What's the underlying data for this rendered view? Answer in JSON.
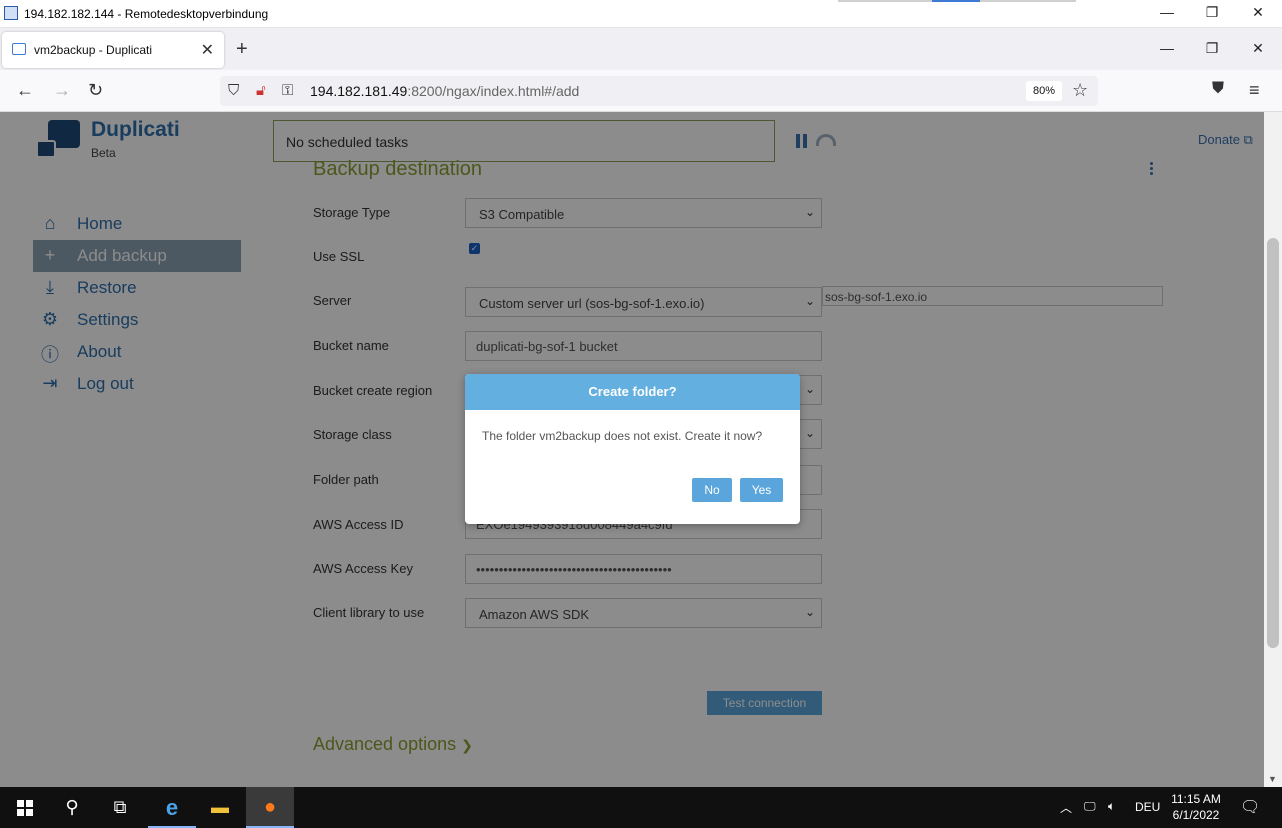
{
  "rdp": {
    "title": "194.182.182.144 - Remotedesktopverbindung"
  },
  "window_controls": {
    "minimize": "—",
    "restore": "❐",
    "close": "✕"
  },
  "browser": {
    "tab_title": "vm2backup - Duplicati",
    "url_host": "194.182.181.49",
    "url_rest": ":8200/ngax/index.html#/add",
    "zoom": "80%"
  },
  "app": {
    "name": "Duplicati",
    "subtitle": "Beta",
    "status": "No scheduled tasks",
    "donate": "Donate",
    "section_title": "Backup destination",
    "advanced_options": "Advanced options"
  },
  "sidebar": {
    "items": [
      {
        "label": "Home",
        "icon": "home-icon",
        "active": false
      },
      {
        "label": "Add backup",
        "icon": "plus-icon",
        "active": true
      },
      {
        "label": "Restore",
        "icon": "restore-icon",
        "active": false
      },
      {
        "label": "Settings",
        "icon": "gear-icon",
        "active": false
      },
      {
        "label": "About",
        "icon": "info-icon",
        "active": false
      },
      {
        "label": "Log out",
        "icon": "logout-icon",
        "active": false
      }
    ]
  },
  "form": {
    "storage_type": {
      "label": "Storage Type",
      "value": "S3 Compatible"
    },
    "use_ssl": {
      "label": "Use SSL",
      "checked": true
    },
    "server": {
      "label": "Server",
      "value": "Custom server url (sos-bg-sof-1.exo.io)",
      "custom_value": "sos-bg-sof-1.exo.io"
    },
    "bucket_name": {
      "label": "Bucket name",
      "value": "duplicati-bg-sof-1 bucket"
    },
    "bucket_region": {
      "label": "Bucket create region"
    },
    "storage_class": {
      "label": "Storage class"
    },
    "folder_path": {
      "label": "Folder path"
    },
    "aws_access_id": {
      "label": "AWS Access ID",
      "value": "EXOe1949393918d008449a4c9fd"
    },
    "aws_access_key": {
      "label": "AWS Access Key",
      "value": "•••••••••••••••••••••••••••••••••••••••••••"
    },
    "client_library": {
      "label": "Client library to use",
      "value": "Amazon AWS SDK"
    },
    "test_connection": "Test connection"
  },
  "dialog": {
    "title": "Create folder?",
    "message": "The folder vm2backup does not exist. Create it now?",
    "no": "No",
    "yes": "Yes"
  },
  "taskbar": {
    "language": "DEU",
    "time": "11:15 AM",
    "date": "6/1/2022"
  }
}
